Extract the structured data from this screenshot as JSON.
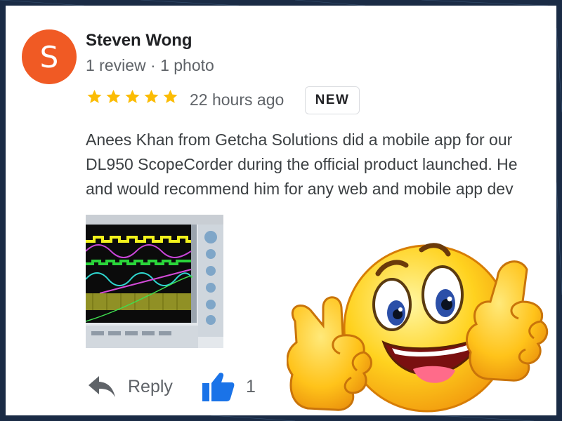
{
  "review": {
    "avatar_initial": "S",
    "reviewer_name": "Steven Wong",
    "reviewer_meta": "1 review · 1 photo",
    "rating": 5,
    "time_ago": "22 hours ago",
    "badge": "NEW",
    "body_lines": [
      "Anees Khan from Getcha Solutions did a mobile app for our",
      "DL950 ScopeCorder during the official product launched. He",
      "and would recommend him for any web and mobile app dev"
    ]
  },
  "actions": {
    "reply_label": "Reply",
    "like_count": "1"
  },
  "colors": {
    "avatar": "#f05a24",
    "star": "#fbbc04",
    "like": "#1a73e8",
    "background": "#1a2b45"
  },
  "icons": [
    "star-icon",
    "reply-arrow-icon",
    "thumbs-up-icon",
    "thumbs-up-emoji-icon"
  ]
}
